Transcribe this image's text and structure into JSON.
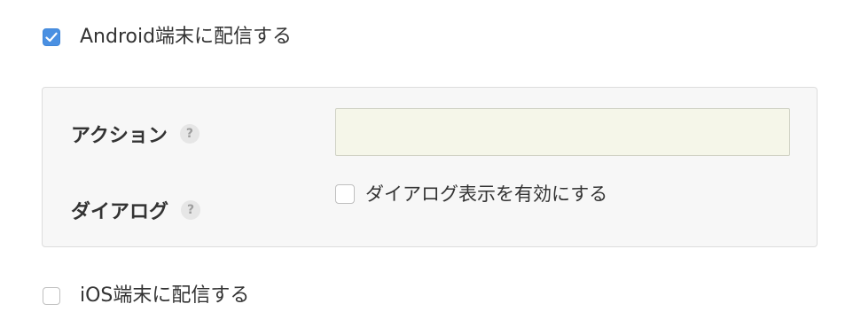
{
  "android": {
    "label": "Android端末に配信する",
    "checked": true
  },
  "panel": {
    "action": {
      "label": "アクション",
      "help": "?",
      "value": "",
      "placeholder": ""
    },
    "dialog": {
      "label": "ダイアログ",
      "help": "?",
      "enable_label": "ダイアログ表示を有効にする",
      "checked": false
    }
  },
  "ios": {
    "label": "iOS端末に配信する",
    "checked": false
  },
  "colors": {
    "accent": "#4a90e2",
    "panel_bg": "#f7f7f7",
    "input_bg": "#f5f6e9"
  },
  "icons": {
    "check": "check-icon",
    "help": "help-icon"
  }
}
